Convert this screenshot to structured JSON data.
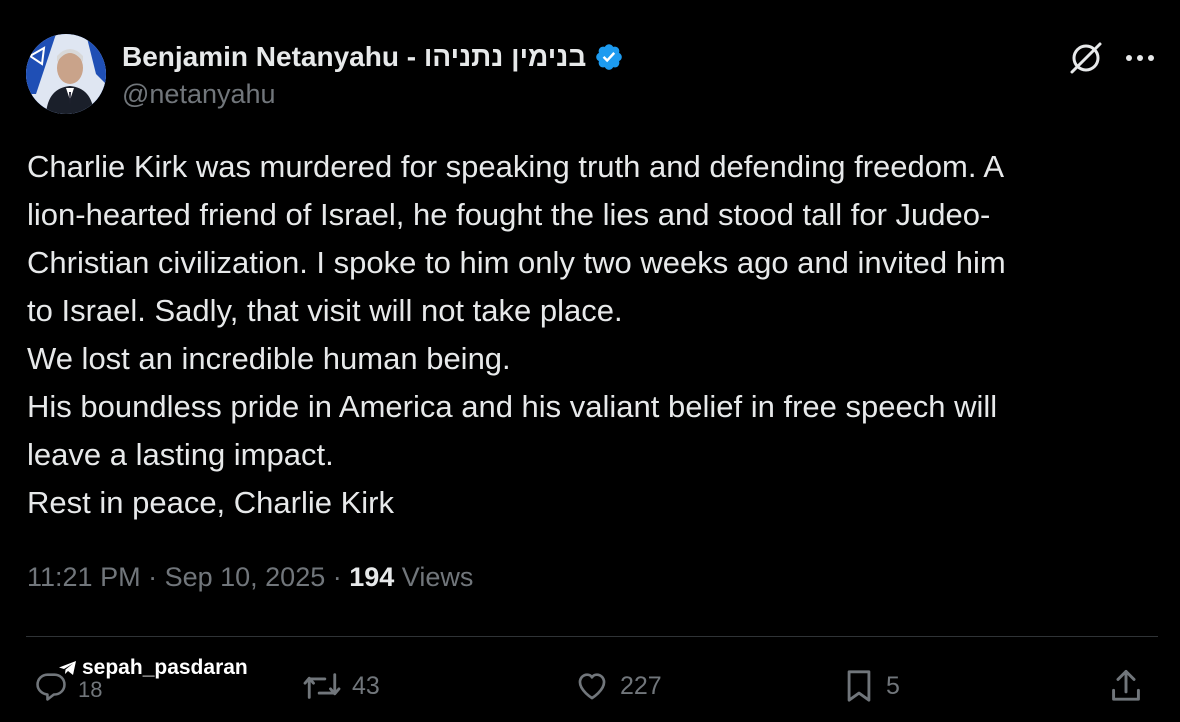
{
  "author": {
    "display_name": "Benjamin Netanyahu - בנימין נתניהו",
    "handle": "@netanyahu",
    "verified": true,
    "avatar_icon": "avatar-portrait"
  },
  "header_icons": {
    "grok": "grok-icon",
    "more": "more-icon"
  },
  "tweet": {
    "lines": [
      "Charlie Kirk was murdered for speaking truth and defending freedom. A",
      "lion-hearted friend of Israel, he fought the lies and stood tall for Judeo-",
      "Christian civilization. I spoke to him only two weeks ago and invited him",
      "to Israel. Sadly, that visit will not take place.",
      "We lost an incredible human being.",
      "His boundless pride in America and his valiant belief in free speech will",
      "leave a lasting impact.",
      "Rest in peace, Charlie Kirk"
    ]
  },
  "meta": {
    "time": "11:21 PM",
    "separator": " · ",
    "date": "Sep 10, 2025",
    "views_count": "194",
    "views_label": " Views"
  },
  "actions": {
    "reply_count": "18",
    "retweet_count": "43",
    "like_count": "227",
    "bookmark_count": "5"
  },
  "watermark": {
    "text": "sepah_pasdaran"
  },
  "colors": {
    "background": "#000000",
    "text": "#e7e9ea",
    "secondary": "#71767b",
    "divider": "#2f3336",
    "verified": "#1d9bf0"
  }
}
